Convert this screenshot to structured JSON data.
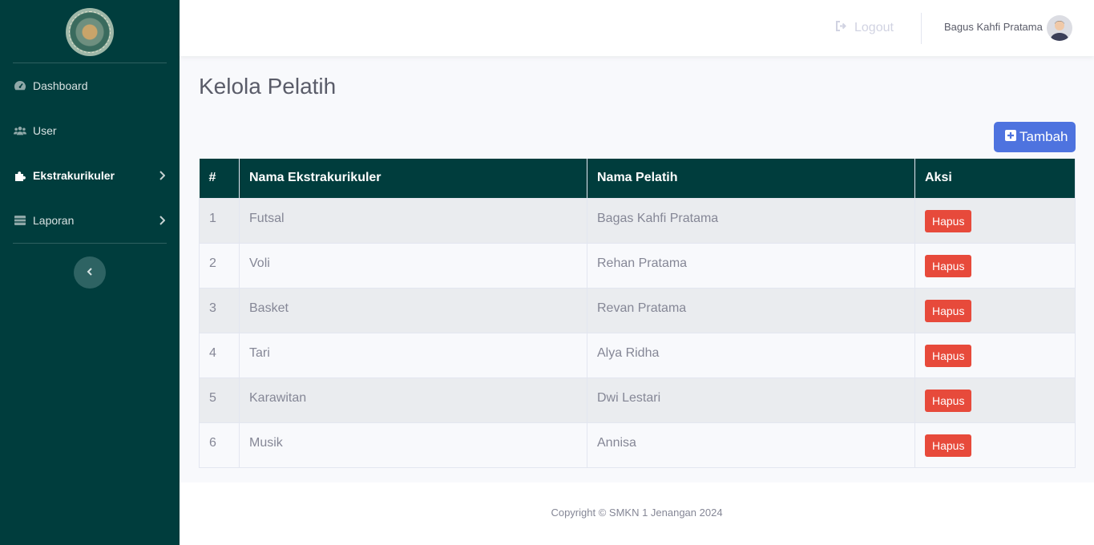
{
  "sidebar": {
    "items": [
      {
        "label": "Dashboard",
        "icon": "tachometer-icon"
      },
      {
        "label": "User",
        "icon": "users-icon"
      },
      {
        "label": "Ekstrakurikuler",
        "icon": "puzzle-icon",
        "active": true
      },
      {
        "label": "Laporan",
        "icon": "table-icon"
      }
    ]
  },
  "topbar": {
    "logout_label": "Logout",
    "username": "Bagus Kahfi Pratama"
  },
  "main": {
    "title": "Kelola Pelatih",
    "add_button_label": "Tambah",
    "table": {
      "headers": [
        "#",
        "Nama Ekstrakurikuler",
        "Nama Pelatih",
        "Aksi"
      ],
      "action_label": "Hapus",
      "rows": [
        {
          "no": "1",
          "ekskul": "Futsal",
          "pelatih": "Bagas Kahfi Pratama"
        },
        {
          "no": "2",
          "ekskul": "Voli",
          "pelatih": "Rehan Pratama"
        },
        {
          "no": "3",
          "ekskul": "Basket",
          "pelatih": "Revan Pratama"
        },
        {
          "no": "4",
          "ekskul": "Tari",
          "pelatih": "Alya Ridha"
        },
        {
          "no": "5",
          "ekskul": "Karawitan",
          "pelatih": "Dwi Lestari"
        },
        {
          "no": "6",
          "ekskul": "Musik",
          "pelatih": "Annisa"
        }
      ]
    }
  },
  "footer": {
    "copyright": "Copyright © SMKN 1 Jenangan 2024"
  },
  "colors": {
    "sidebar": "#003d3d",
    "primary": "#4e73df",
    "danger": "#e74a3b"
  }
}
